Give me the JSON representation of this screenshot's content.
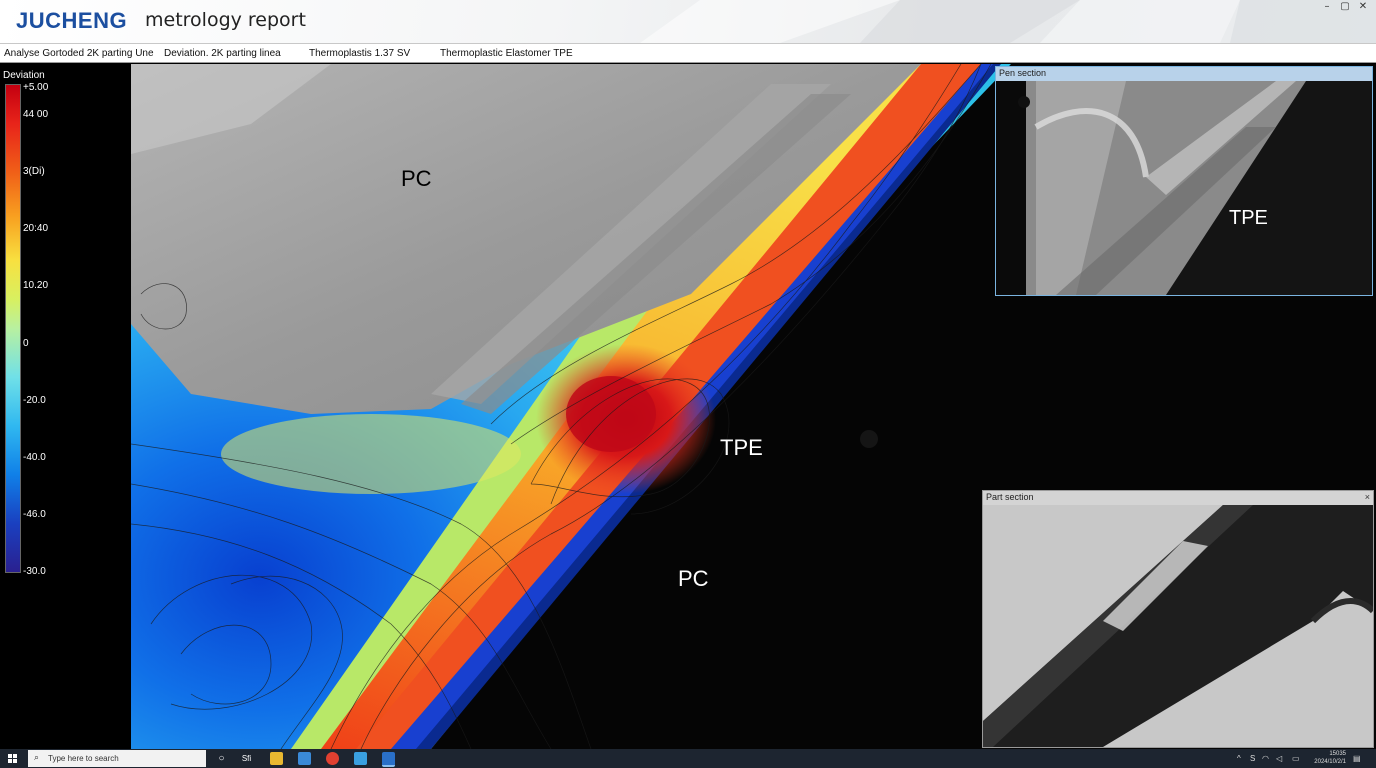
{
  "header": {
    "brand": "JUCHENG",
    "title": "metrology report",
    "controls": [
      "–",
      "▢",
      "✕"
    ]
  },
  "infobar": {
    "analysis": "Analyse Gortoded 2K parting Une",
    "deviation": "Deviation.  2K parting linea",
    "thermoplastic": "Thermoplastis 1.37 SV",
    "material": "Thermoplastic Elastomer TPE"
  },
  "legend": {
    "title": "Deviation",
    "ticks": [
      "+5.00",
      "44 00",
      "3(Di)",
      "20:40",
      "10.20",
      "0",
      "-20.0",
      "-40.0",
      "-46.0",
      "-30.0"
    ]
  },
  "viewport": {
    "labels": {
      "pc_top": "PC",
      "tpe_center": "TPE",
      "pc_bottom": "PC"
    }
  },
  "inset_top": {
    "title": "Pen section",
    "label": "TPE"
  },
  "inset_bottom": {
    "title": "Part section",
    "close": "×"
  },
  "taskbar": {
    "search_placeholder": "Type here to search",
    "tray_text": "Sfi",
    "clock_time": "15035",
    "clock_date": "2024/10/2/1"
  }
}
